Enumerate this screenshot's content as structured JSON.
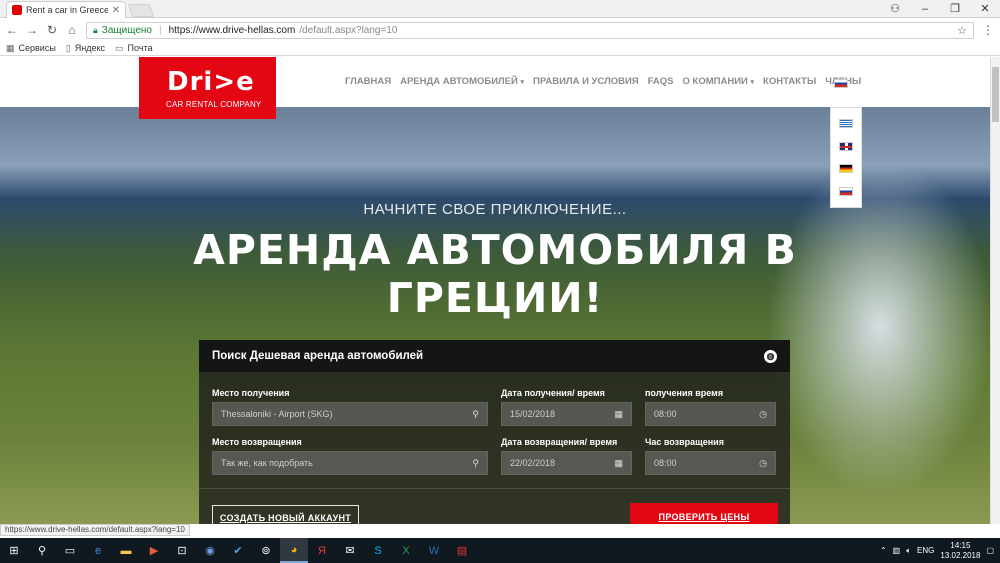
{
  "browser": {
    "tab_title": "Rent a car in Greece - Dr",
    "secure_label": "Защищено",
    "url_host": "https://www.drive-hellas.com",
    "url_path": "/default.aspx?lang=10",
    "bookmarks": [
      {
        "label": "Сервисы",
        "icon": "apps-icon"
      },
      {
        "label": "Яндекс",
        "icon": "page-icon"
      },
      {
        "label": "Почта",
        "icon": "mail-icon"
      }
    ],
    "status_url": "https://www.drive-hellas.com/default.aspx?lang=10"
  },
  "site": {
    "logo": {
      "name": "Dri>e",
      "tagline": "CAR RENTAL COMPANY"
    },
    "nav": [
      "ГЛАВНАЯ",
      "АРЕНДА АВТОМОБИЛЕЙ",
      "ПРАВИЛА И УСЛОВИЯ",
      "FAQS",
      "О КОМПАНИИ",
      "КОНТАКТЫ",
      "ЧЛЕНЫ"
    ],
    "current_language": "ru",
    "languages": [
      "gr",
      "en",
      "de",
      "ru"
    ],
    "brand_color": "#e30613"
  },
  "hero": {
    "subtitle": "НАЧНИТЕ СВОЕ ПРИКЛЮЧЕНИЕ...",
    "title_line1": "АРЕНДА АВТОМОБИЛЯ В",
    "title_line2": "ГРЕЦИИ!"
  },
  "search": {
    "title": "Поиск Дешевая аренда автомобилей",
    "pickup_location_label": "Место получения",
    "pickup_location_value": "Thessaloniki - Airport (SKG)",
    "pickup_date_label": "Дата получения/ время",
    "pickup_date_value": "15/02/2018",
    "pickup_time_label": "получения время",
    "pickup_time_value": "08:00",
    "return_location_label": "Место возвращения",
    "return_location_placeholder": "Так же, как подобрать",
    "return_date_label": "Дата возвращения/ время",
    "return_date_value": "22/02/2018",
    "return_time_label": "Час возвращения",
    "return_time_value": "08:00",
    "create_account_label": "СОЗДАТЬ НОВЫЙ АККАУНТ",
    "check_prices_label": "ПРОВЕРИТЬ ЦЕНЫ"
  },
  "taskbar": {
    "language": "ENG",
    "time": "14:15",
    "date": "13.02.2018"
  }
}
